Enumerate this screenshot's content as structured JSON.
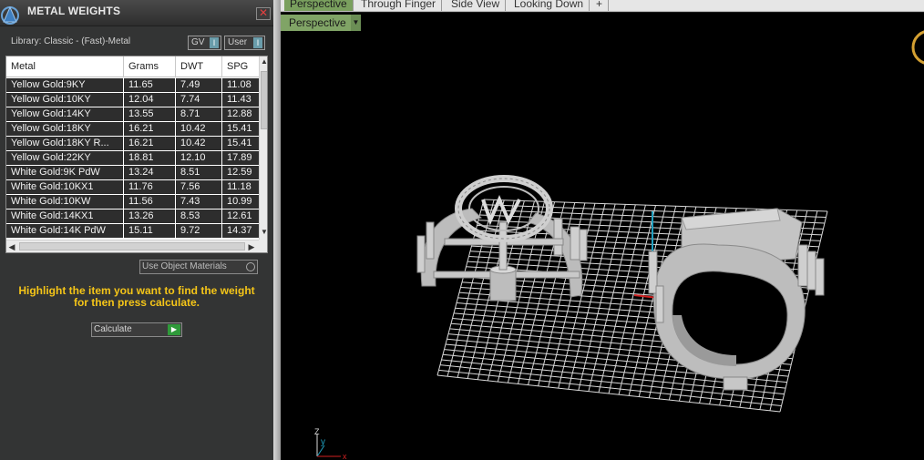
{
  "panel": {
    "title": "METAL WEIGHTS",
    "close_label": "✕",
    "library_label": "Library: Classic - (Fast)-Metal",
    "gv_label": "GV",
    "user_label": "User",
    "toggle_mark": "I"
  },
  "table": {
    "columns": [
      "Metal",
      "Grams",
      "DWT",
      "SPG"
    ],
    "rows": [
      {
        "metal": "Yellow Gold:9KY",
        "grams": "11.65",
        "dwt": "7.49",
        "spg": "11.08"
      },
      {
        "metal": "Yellow Gold:10KY",
        "grams": "12.04",
        "dwt": "7.74",
        "spg": "11.43"
      },
      {
        "metal": "Yellow Gold:14KY",
        "grams": "13.55",
        "dwt": "8.71",
        "spg": "12.88"
      },
      {
        "metal": "Yellow Gold:18KY",
        "grams": "16.21",
        "dwt": "10.42",
        "spg": "15.41"
      },
      {
        "metal": "Yellow Gold:18KY R...",
        "grams": "16.21",
        "dwt": "10.42",
        "spg": "15.41"
      },
      {
        "metal": "Yellow Gold:22KY",
        "grams": "18.81",
        "dwt": "12.10",
        "spg": "17.89"
      },
      {
        "metal": "White Gold:9K PdW",
        "grams": "13.24",
        "dwt": "8.51",
        "spg": "12.59"
      },
      {
        "metal": "White Gold:10KX1",
        "grams": "11.76",
        "dwt": "7.56",
        "spg": "11.18"
      },
      {
        "metal": "White Gold:10KW",
        "grams": "11.56",
        "dwt": "7.43",
        "spg": "10.99"
      },
      {
        "metal": "White Gold:14KX1",
        "grams": "13.26",
        "dwt": "8.53",
        "spg": "12.61"
      },
      {
        "metal": "White Gold:14K PdW",
        "grams": "15.11",
        "dwt": "9.72",
        "spg": "14.37"
      }
    ]
  },
  "use_object_materials": "Use Object Materials",
  "hint": {
    "line1": "Highlight the item you want to find the weight",
    "line2": "for then press calculate."
  },
  "calculate_label": "Calculate",
  "tabs": [
    "Perspective",
    "Through Finger",
    "Side View",
    "Looking Down",
    "+"
  ],
  "active_tab": "Perspective",
  "viewport": {
    "label": "Perspective",
    "axes": {
      "z": "Z",
      "y": "y",
      "x": "x"
    }
  },
  "colors": {
    "accent_green": "#7aa05e",
    "hint_yellow": "#f5c518",
    "axis_red": "#d02020",
    "axis_cyan": "#20a0c0"
  }
}
